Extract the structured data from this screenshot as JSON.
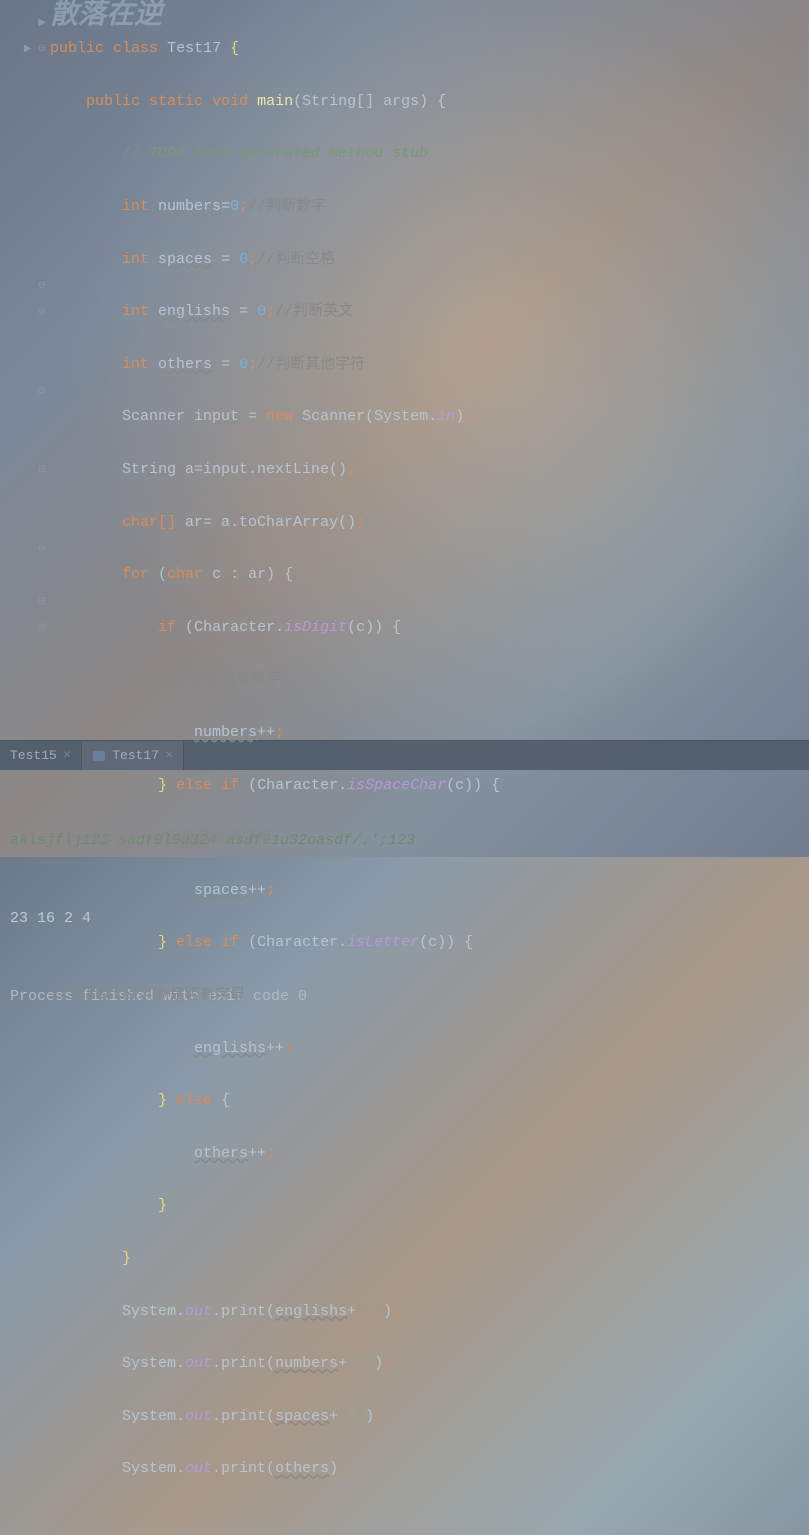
{
  "watermark": "散落在逆",
  "code": {
    "l1_public": "public",
    "l1_class": "class",
    "l1_name": "Test17",
    "l1_brace": "{",
    "l2_public": "public",
    "l2_static": "static",
    "l2_void": "void",
    "l2_main": "main",
    "l2_params": "(String[] args)",
    "l2_brace": "{",
    "l3_slash": "//",
    "l3_todo": " TODO Auto-generated method stub",
    "l4_int": "int",
    "l4_var": "numbers",
    "l4_eq": "=",
    "l4_val": "0",
    "l4_semi": ";",
    "l4_comment": "//判断数字",
    "l5_int": "int",
    "l5_var": "spaces",
    "l5_eq": " = ",
    "l5_val": "0",
    "l5_semi": ";",
    "l5_comment": "//判断空格",
    "l6_int": "int",
    "l6_var": "englishs",
    "l6_eq": " = ",
    "l6_val": "0",
    "l6_semi": ";",
    "l6_comment": "//判断英文",
    "l7_int": "int",
    "l7_var": "others",
    "l7_eq": " = ",
    "l7_val": "0",
    "l7_semi": ";",
    "l7_comment": "//判断其他字符",
    "l8_pre": "Scanner input = ",
    "l8_new": "new",
    "l8_post": " Scanner(System.",
    "l8_in": "in",
    "l8_close": ")",
    "l8_semi": ";",
    "l9_text": "String a=input.nextLine()",
    "l9_semi": ";",
    "l10_char": "char",
    "l10_br": "[]",
    "l10_text": " ar= a.toCharArray()",
    "l10_semi": ";",
    "l11_for": "for",
    "l11_open": " (",
    "l11_char": "char",
    "l11_rest": " c : ar",
    "l11_close": ")",
    "l11_brace": " {",
    "l12_if": "if",
    "l12_open": " (",
    "l12_cls": "Character.",
    "l12_method": "isDigit",
    "l12_open2": "(",
    "l12_c": "c",
    "l12_close": "))",
    "l12_brace": " {",
    "l13": "//isDigit判断数组中是否有数字",
    "l14_var": "numbers",
    "l14_op": "++",
    "l14_semi": ";",
    "l15_close": "}",
    "l15_else": " else ",
    "l15_if": "if",
    "l15_open": " (",
    "l15_cls": "Character.",
    "l15_method": "isSpaceChar",
    "l15_open2": "(",
    "l15_c": "c",
    "l15_close2": "))",
    "l15_brace": " {",
    "l16": "//isSpaceChar判断是否有空格",
    "l17_var": "spaces",
    "l17_op": "++",
    "l17_semi": ";",
    "l18_close": "}",
    "l18_else": " else ",
    "l18_if": "if",
    "l18_open": " (",
    "l18_cls": "Character.",
    "l18_method": "isLetter",
    "l18_open2": "(",
    "l18_c": "c",
    "l18_close2": "))",
    "l18_brace": " {",
    "l19": "//isLetter判断是否有字母",
    "l20_var": "englishs",
    "l20_op": "++",
    "l20_semi": ";",
    "l21_close": "}",
    "l21_else": " else ",
    "l21_brace": "{",
    "l22_var": "others",
    "l22_op": "++",
    "l22_semi": ";",
    "l23": "}",
    "l24": "}",
    "l25_pre": "System.",
    "l25_out": "out",
    "l25_print": ".print(",
    "l25_var": "englishs",
    "l25_plus": "+",
    "l25_str": "\" \"",
    "l25_close": ")",
    "l25_semi": ";",
    "l26_pre": "System.",
    "l26_out": "out",
    "l26_print": ".print(",
    "l26_var": "numbers",
    "l26_plus": "+",
    "l26_str": "\" \"",
    "l26_close": ")",
    "l26_semi": ";",
    "l27_pre": "System.",
    "l27_out": "out",
    "l27_print": ".print(",
    "l27_var": "spaces",
    "l27_plus": "+",
    "l27_str": "\" \"",
    "l27_close": ")",
    "l27_semi": ";",
    "l28_pre": "System.",
    "l28_out": "out",
    "l28_print": ".print(",
    "l28_var": "others",
    "l28_close": ")",
    "l28_semi": ";"
  },
  "tabs": {
    "t1": "Test15",
    "t2": "Test17"
  },
  "console": {
    "input": "aklsjflj123 sadf9l9u324 asdf91u32oasdf/.';123",
    "output": "23 16 2 4",
    "exit": "Process finished with exit code 0"
  }
}
